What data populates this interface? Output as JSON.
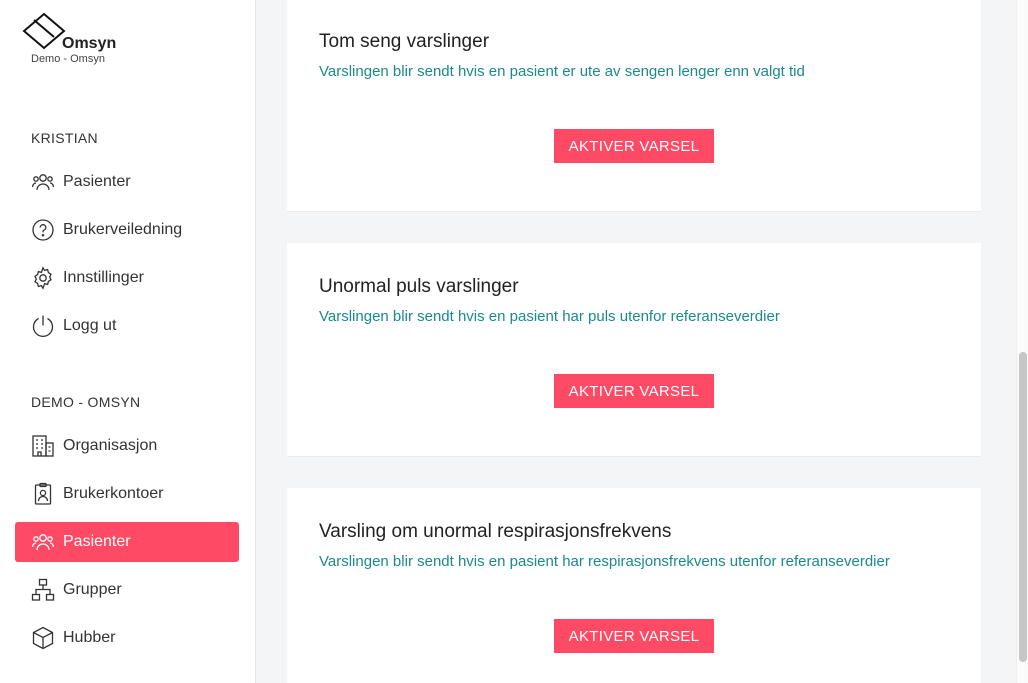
{
  "brand": {
    "name": "Omsyn",
    "subtitle": "Demo - Omsyn"
  },
  "sections": {
    "user": {
      "title": "KRISTIAN",
      "items": [
        {
          "label": "Pasienter",
          "icon": "users-icon"
        },
        {
          "label": "Brukerveiledning",
          "icon": "help-circle-icon"
        },
        {
          "label": "Innstillinger",
          "icon": "gear-icon"
        },
        {
          "label": "Logg ut",
          "icon": "power-icon"
        }
      ]
    },
    "org": {
      "title": "DEMO - OMSYN",
      "items": [
        {
          "label": "Organisasjon",
          "icon": "building-icon"
        },
        {
          "label": "Brukerkontoer",
          "icon": "id-badge-icon"
        },
        {
          "label": "Pasienter",
          "icon": "users-icon",
          "active": true
        },
        {
          "label": "Grupper",
          "icon": "hierarchy-icon"
        },
        {
          "label": "Hubber",
          "icon": "cube-icon"
        }
      ]
    }
  },
  "cards": [
    {
      "title": "Tom seng varslinger",
      "description": "Varslingen blir sendt hvis en pasient er ute av sengen lenger enn valgt tid",
      "button": "AKTIVER VARSEL"
    },
    {
      "title": "Unormal puls varslinger",
      "description": "Varslingen blir sendt hvis en pasient har puls utenfor referanseverdier",
      "button": "AKTIVER VARSEL"
    },
    {
      "title": "Varsling om unormal respirasjonsfrekvens",
      "description": "Varslingen blir sendt hvis en pasient har respirasjonsfrekvens utenfor referanseverdier",
      "button": "AKTIVER VARSEL"
    }
  ],
  "colors": {
    "accent": "#fe4a64",
    "link": "#1a8a8c"
  }
}
